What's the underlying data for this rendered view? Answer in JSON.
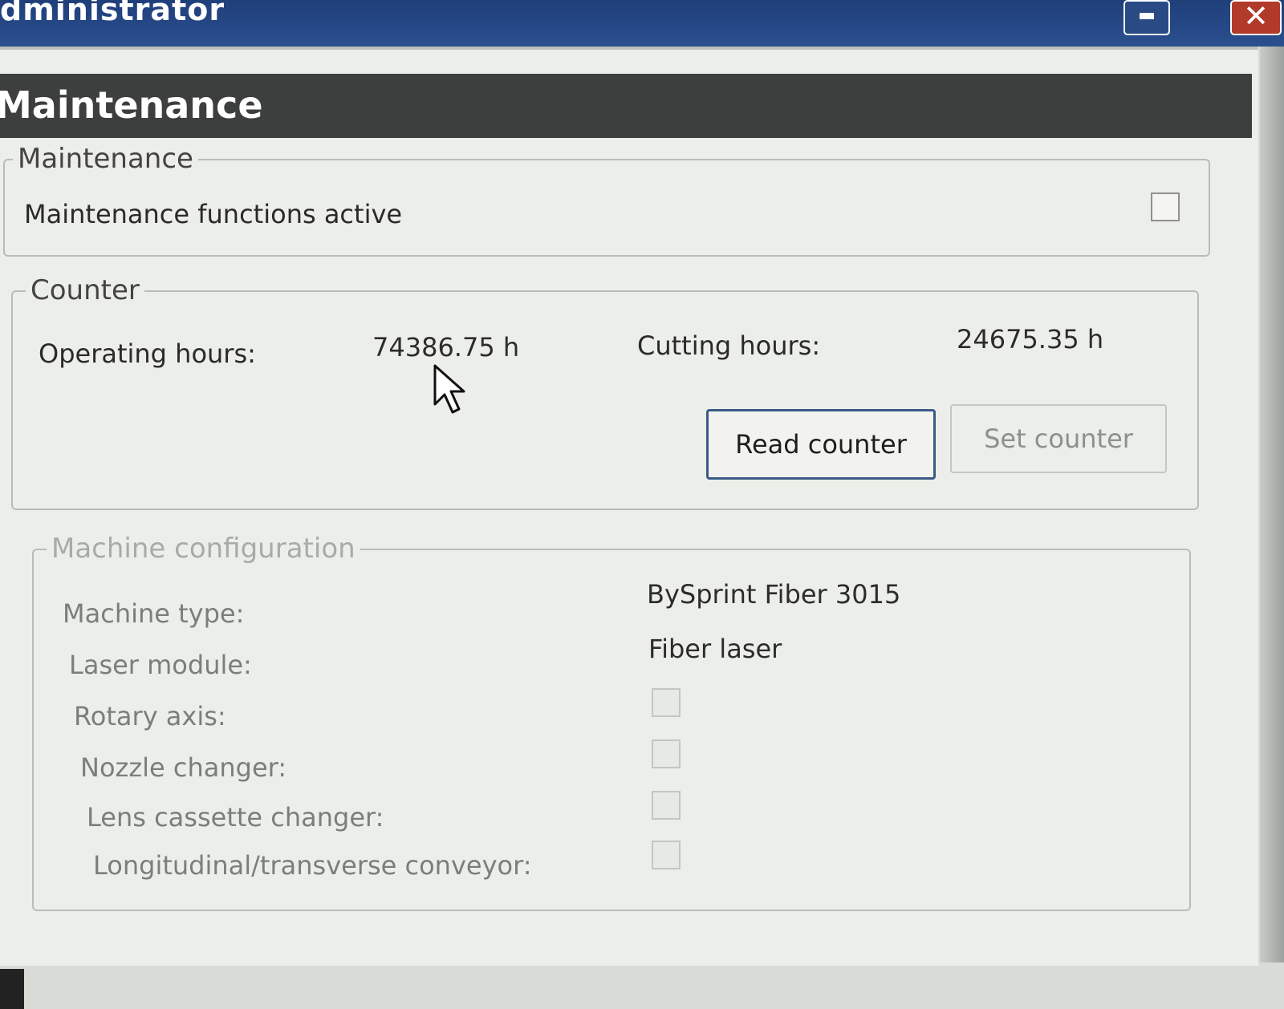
{
  "window": {
    "title": "dministrator",
    "controls": {
      "minimize_icon": "minimize-icon",
      "close_icon": "✕"
    }
  },
  "header": {
    "title": "Maintenance"
  },
  "maintenance_group": {
    "legend": "Maintenance",
    "row_label": "Maintenance functions active",
    "checked": false
  },
  "counter_group": {
    "legend": "Counter",
    "operating_hours_label": "Operating hours:",
    "operating_hours_value": "74386.75 h",
    "cutting_hours_label": "Cutting hours:",
    "cutting_hours_value": "24675.35 h",
    "read_button": "Read counter",
    "set_button": "Set counter"
  },
  "machine_config_group": {
    "legend": "Machine configuration",
    "rows": [
      {
        "label": "Machine type:",
        "value": "BySprint Fiber 3015"
      },
      {
        "label": "Laser module:",
        "value": "Fiber laser"
      },
      {
        "label": "Rotary axis:",
        "checked": false
      },
      {
        "label": "Nozzle changer:",
        "checked": false
      },
      {
        "label": "Lens cassette changer:",
        "checked": false
      },
      {
        "label": "Longitudinal/transverse conveyor:",
        "checked": false
      }
    ]
  },
  "colors": {
    "titlebar": "#2b4f8f",
    "header": "#3d3f3e",
    "panel": "#eceee9",
    "button_border": "#3a5a86"
  }
}
